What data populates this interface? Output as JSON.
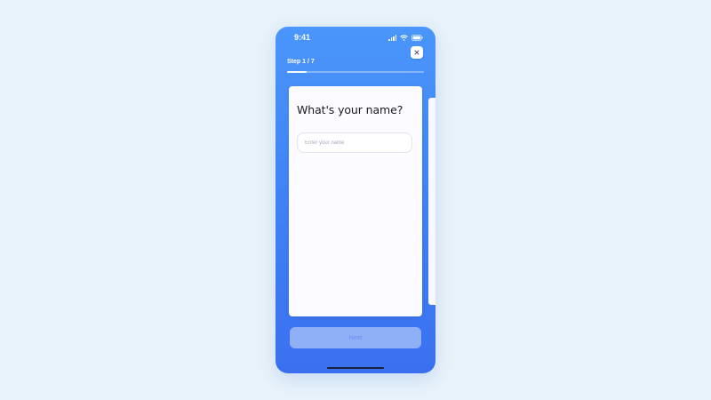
{
  "status_bar": {
    "time": "9:41",
    "icons": [
      "signal-icon",
      "wifi-icon",
      "battery-icon"
    ]
  },
  "header": {
    "close_icon": "close-icon",
    "step_label": "Step 1 / 7",
    "progress": 0.14
  },
  "card": {
    "question": "What's your name?",
    "name_input": {
      "value": "",
      "placeholder": "Enter your name"
    }
  },
  "footer": {
    "next_label": "Next"
  },
  "colors": {
    "background": "#e7f2fa",
    "phone_gradient_top": "#4a96fa",
    "phone_gradient_bottom": "#3a70ef",
    "card": "#fcfbff",
    "next_button_text": "#6e8ef0"
  }
}
